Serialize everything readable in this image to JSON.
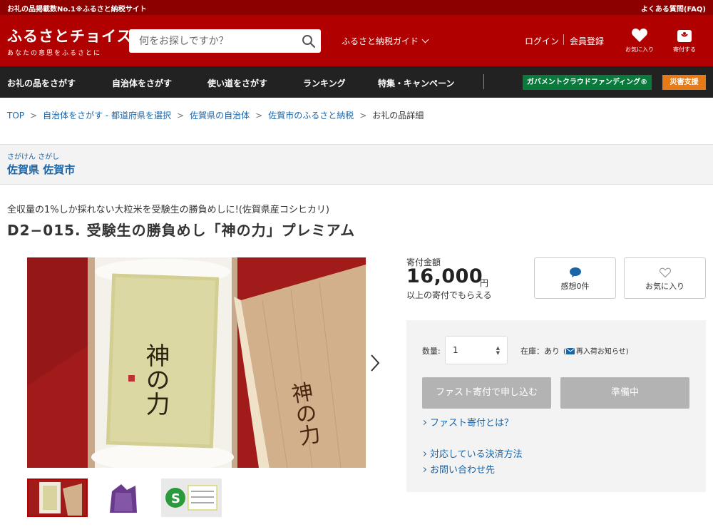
{
  "topbar": {
    "left_text": "お礼の品掲載数No.1※ふるさと納税サイト",
    "faq": "よくある質問(FAQ)"
  },
  "header": {
    "logo_main": "ふるさとチョイス",
    "logo_sub": "あなたの意思をふるさとに",
    "search_placeholder": "何をお探しですか？",
    "guide_label": "ふるさと納税ガイド",
    "login": "ログイン",
    "register": "会員登録",
    "favorites_label": "お気に入り",
    "donate_label": "寄付する"
  },
  "nav": {
    "items": [
      "お礼の品をさがす",
      "自治体をさがす",
      "使い道をさがす",
      "ランキング",
      "特集・キャンペーン"
    ],
    "gcf": "ガバメントクラウドファンディング®",
    "disaster": "災害支援"
  },
  "breadcrumbs": [
    "TOP",
    "自治体をさがす - 都道府県を選択",
    "佐賀県の自治体",
    "佐賀市のふるさと納税",
    "お礼の品詳細"
  ],
  "municipality": {
    "ruby": "さがけん さがし",
    "name": "佐賀県 佐賀市"
  },
  "product": {
    "subtitle": "全収量の1%しか採れない大粒米を受験生の勝負めしに!(佐賀県産コシヒカリ)",
    "title": "D2−015. 受験生の勝負めし「神の力」プレミアム"
  },
  "donation": {
    "label": "寄付金額",
    "amount": "16,000",
    "unit": "円",
    "note": "以上の寄付でもらえる"
  },
  "social": {
    "reviews": "感想0件",
    "favorite": "お気に入り"
  },
  "order": {
    "qty_label": "数量:",
    "qty_value": "1",
    "stock": "在庫：あり",
    "restock": "再入荷お知らせ)",
    "fast_button": "ファスト寄付で申し込む",
    "prep_button": "準備中",
    "link_fast": "ファスト寄付とは？",
    "link_payment": "対応している決済方法",
    "link_contact": "お問い合わせ先"
  },
  "image": {
    "calligraphy": "神の力"
  },
  "colors": {
    "brand_red": "#b00000",
    "top_strip": "#8c0000",
    "nav_bg": "#222222",
    "gcf_green": "#0a7a3c",
    "disaster_orange": "#e67a16",
    "link_blue": "#1a64a8"
  }
}
